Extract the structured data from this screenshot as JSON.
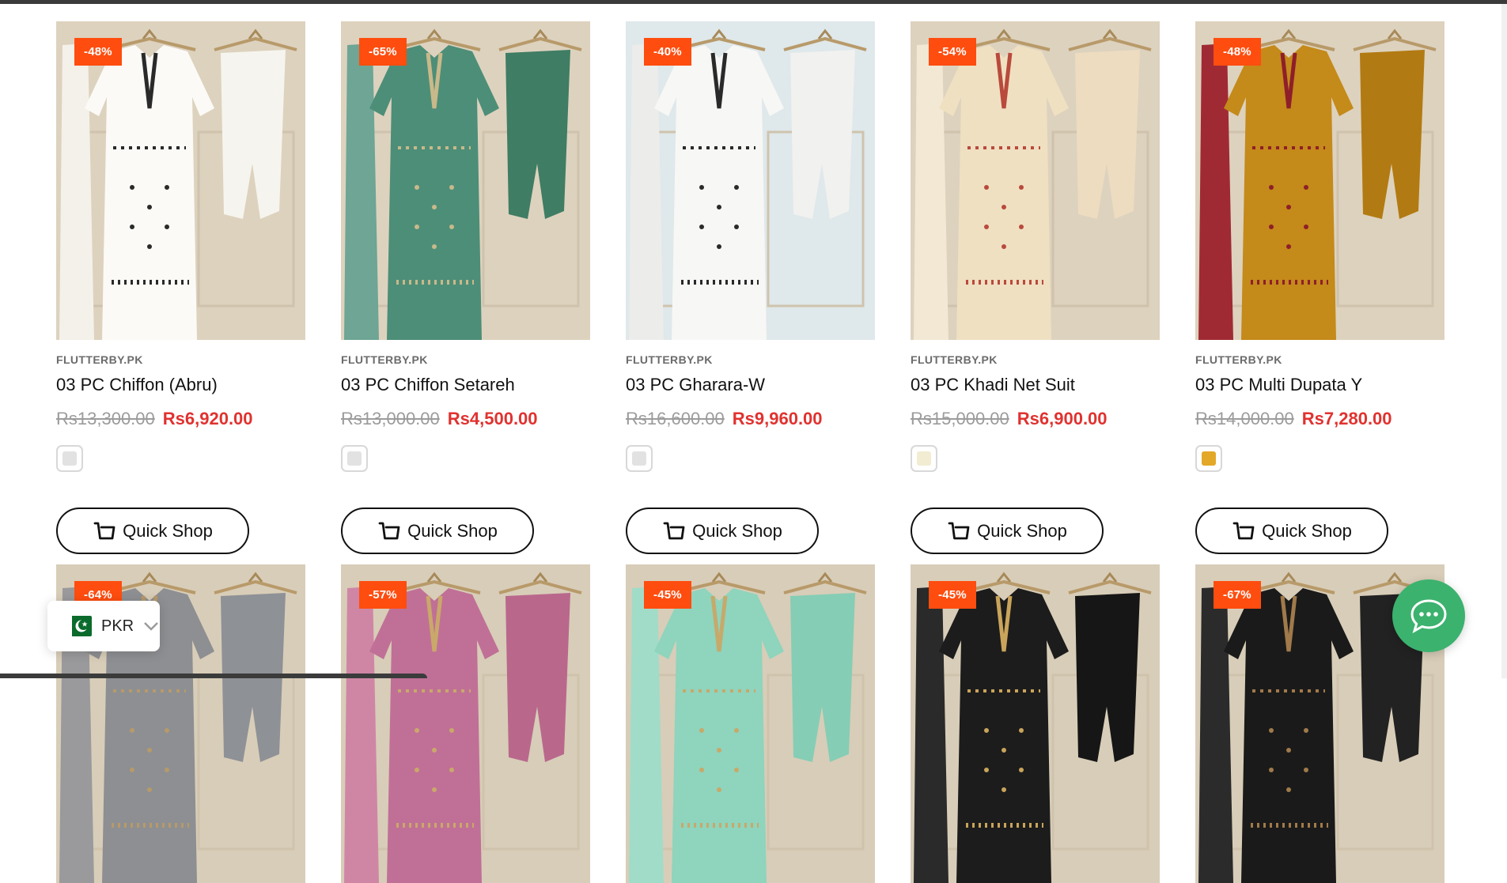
{
  "products": [
    {
      "badge": "-48%",
      "vendor": "FLUTTERBY.PK",
      "title": "03 PC Chiffon (Abru)",
      "old_price": "Rs13,300.00",
      "new_price": "Rs6,920.00",
      "swatch_color": "#e2e2e2",
      "quick_shop": "Quick Shop",
      "image": {
        "bg": "#ddd2be",
        "dress": "#fbfaf6",
        "trim": "#2a2a2a",
        "pants": "#f6f4ee",
        "dupatta": "#f4f1ea"
      }
    },
    {
      "badge": "-65%",
      "vendor": "FLUTTERBY.PK",
      "title": "03 PC Chiffon Setareh",
      "old_price": "Rs13,000.00",
      "new_price": "Rs4,500.00",
      "swatch_color": "#e2e2e2",
      "quick_shop": "Quick Shop",
      "image": {
        "bg": "#ddd2be",
        "dress": "#4d8e78",
        "trim": "#c9b98a",
        "pants": "#3f7d64",
        "dupatta": "#6ea595"
      }
    },
    {
      "badge": "-40%",
      "vendor": "FLUTTERBY.PK",
      "title": "03 PC Gharara-W",
      "old_price": "Rs16,600.00",
      "new_price": "Rs9,960.00",
      "swatch_color": "#e2e2e2",
      "quick_shop": "Quick Shop",
      "image": {
        "bg": "#dfe8ea",
        "dress": "#f7f7f5",
        "trim": "#2a2a2a",
        "pants": "#f1f1ef",
        "dupatta": "#ececea"
      }
    },
    {
      "badge": "-54%",
      "vendor": "FLUTTERBY.PK",
      "title": "03 PC Khadi Net Suit",
      "old_price": "Rs15,000.00",
      "new_price": "Rs6,900.00",
      "swatch_color": "#f2ecd2",
      "quick_shop": "Quick Shop",
      "image": {
        "bg": "#ddd2be",
        "dress": "#efe0c2",
        "trim": "#b94a3c",
        "pants": "#eddcc0",
        "dupatta": "#f3e8d3"
      }
    },
    {
      "badge": "-48%",
      "vendor": "FLUTTERBY.PK",
      "title": "03 PC Multi Dupata Y",
      "old_price": "Rs14,000.00",
      "new_price": "Rs7,280.00",
      "swatch_color": "#e3a828",
      "quick_shop": "Quick Shop",
      "image": {
        "bg": "#ddd2be",
        "dress": "#c48a1a",
        "trim": "#8e1f2a",
        "pants": "#b27a12",
        "dupatta": "#a02a34"
      }
    }
  ],
  "row2_products": [
    {
      "badge": "-64%",
      "image": {
        "bg": "#d8cdb8",
        "dress": "#8d8f92",
        "trim": "#b79a6a",
        "pants": "#8e9196",
        "dupatta": "#9a9a9c"
      }
    },
    {
      "badge": "-57%",
      "image": {
        "bg": "#d8cdb8",
        "dress": "#c07096",
        "trim": "#c9a86a",
        "pants": "#b9688c",
        "dupatta": "#cf86a5"
      }
    },
    {
      "badge": "-45%",
      "image": {
        "bg": "#d8cdb8",
        "dress": "#8fd4bd",
        "trim": "#c7a96a",
        "pants": "#86cdb5",
        "dupatta": "#a1dcc8"
      }
    },
    {
      "badge": "-45%",
      "image": {
        "bg": "#d8cdb8",
        "dress": "#1c1c1c",
        "trim": "#c9a45a",
        "pants": "#161616",
        "dupatta": "#2a2a2a"
      }
    },
    {
      "badge": "-67%",
      "image": {
        "bg": "#d8cdb8",
        "dress": "#1a1a1a",
        "trim": "#a07a4a",
        "pants": "#222222",
        "dupatta": "#2b2b2b"
      }
    }
  ],
  "currency": {
    "code": "PKR",
    "flag_icon": "pakistan-flag-icon",
    "chevron_icon": "chevron-down-icon"
  },
  "chat": {
    "icon": "chat-bubble-icon",
    "color": "#3bb26e"
  },
  "colors": {
    "badge": "#ff4d0f",
    "sale_price": "#e0322f",
    "old_price": "#9c9c9c"
  }
}
